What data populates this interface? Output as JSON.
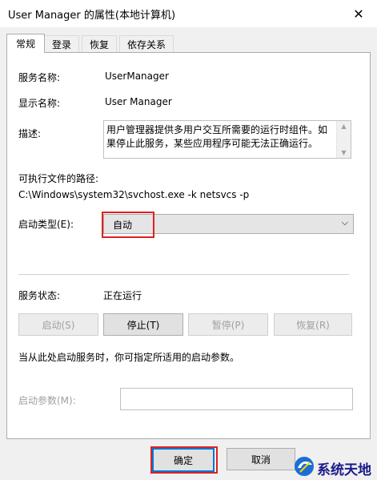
{
  "window": {
    "title": "User Manager 的属性(本地计算机)",
    "close_glyph": "✕"
  },
  "tabs": [
    {
      "label": "常规",
      "active": true
    },
    {
      "label": "登录",
      "active": false
    },
    {
      "label": "恢复",
      "active": false
    },
    {
      "label": "依存关系",
      "active": false
    }
  ],
  "general": {
    "service_name_label": "服务名称:",
    "service_name": "UserManager",
    "display_name_label": "显示名称:",
    "display_name": "User Manager",
    "description_label": "描述:",
    "description": "用户管理器提供多用户交互所需要的运行时组件。如果停止此服务，某些应用程序可能无法正确运行。",
    "exe_path_label": "可执行文件的路径:",
    "exe_path": "C:\\Windows\\system32\\svchost.exe -k netsvcs -p",
    "startup_type_label": "启动类型(E):",
    "startup_type_value": "自动",
    "status_label": "服务状态:",
    "status_value": "正在运行",
    "buttons": {
      "start": "启动(S)",
      "stop": "停止(T)",
      "pause": "暂停(P)",
      "resume": "恢复(R)"
    },
    "hint": "当从此处启动服务时，你可指定所适用的启动参数。",
    "start_params_label": "启动参数(M):",
    "start_params_value": ""
  },
  "footer": {
    "ok": "确定",
    "cancel": "取消"
  },
  "watermark": {
    "text": "系统天地"
  },
  "colors": {
    "highlight": "#e02020",
    "focus": "#0078d7"
  }
}
